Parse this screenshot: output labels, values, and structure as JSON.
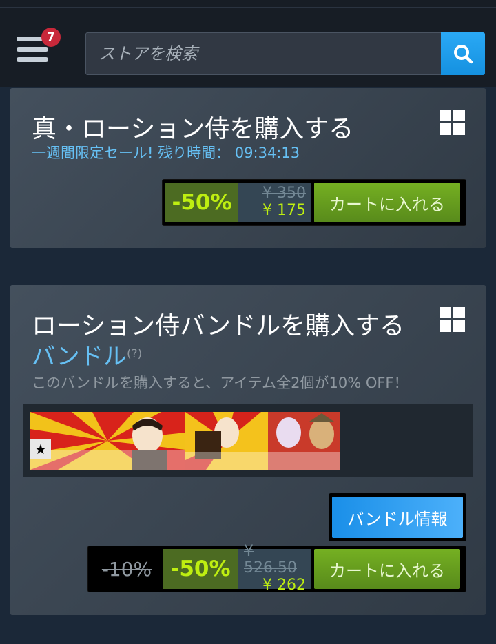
{
  "header": {
    "notification_count": "7",
    "search_placeholder": "ストアを検索"
  },
  "purchase_game": {
    "title": "真・ローション侍を購入する",
    "platform_icon": "windows-icon",
    "sale_text": "一週間限定セール! 残り時間： 09:34:13",
    "discount": "-50%",
    "original_price": "¥ 350",
    "final_price": "¥ 175",
    "cart_label": "カートに入れる"
  },
  "purchase_bundle": {
    "title": "ローション侍バンドルを購入する",
    "platform_icon": "windows-icon",
    "bundle_label": "バンドル",
    "help": "(?)",
    "description": "このバンドルを購入すると、アイテム全2個が10% OFF！",
    "item_star": "★",
    "info_button": "バンドル情報",
    "bundle_discount": "-10%",
    "discount": "-50%",
    "original_price": "¥ 526.50",
    "final_price": "¥ 262",
    "cart_label": "カートに入れる"
  },
  "colors": {
    "background": "#1b2838",
    "accent_blue": "#66c0f4",
    "discount_green": "#beee11",
    "cart_green": "#75b022"
  }
}
